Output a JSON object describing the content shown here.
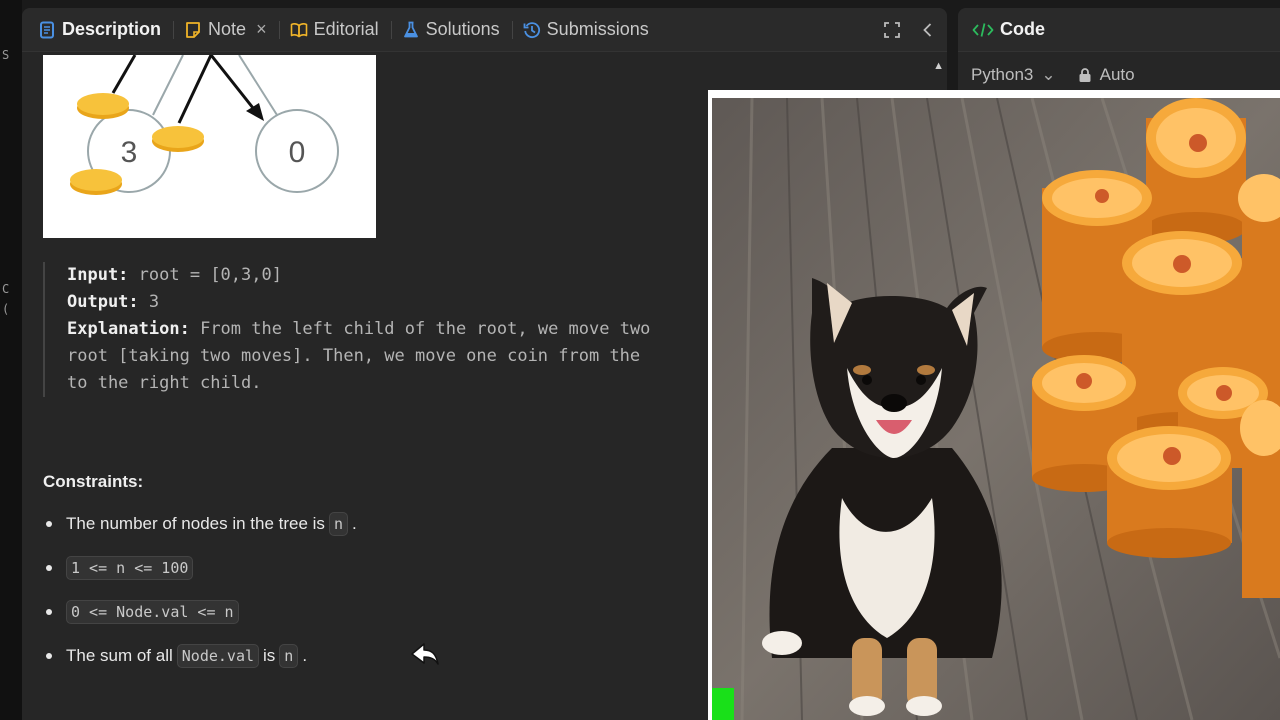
{
  "edge_chars": [
    "S",
    "C",
    "("
  ],
  "tabs": [
    {
      "label": "Description",
      "icon": "document-icon",
      "active": true
    },
    {
      "label": "Note",
      "icon": "note-icon",
      "closable": true
    },
    {
      "label": "Editorial",
      "icon": "book-icon"
    },
    {
      "label": "Solutions",
      "icon": "flask-icon"
    },
    {
      "label": "Submissions",
      "icon": "history-icon"
    }
  ],
  "tab_close_glyph": "×",
  "tree_figure": {
    "left_node": "3",
    "right_node": "0"
  },
  "example": {
    "input_label": "Input:",
    "input_value": "root = [0,3,0]",
    "output_label": "Output:",
    "output_value": "3",
    "explanation_label": "Explanation:",
    "explanation_line1": "From the left child of the root, we move two",
    "explanation_line2": "root [taking two moves]. Then, we move one coin from the",
    "explanation_line3": "to the right child."
  },
  "constraints": {
    "title": "Constraints:",
    "items": [
      {
        "before": "The number of nodes in the tree is",
        "code": "n",
        "after": "."
      },
      {
        "before": "",
        "code": "1 <= n <= 100",
        "after": ""
      },
      {
        "before": "",
        "code": "0 <= Node.val <= n",
        "after": ""
      },
      {
        "before": "The sum of all",
        "code": "Node.val",
        "middle": "is",
        "code2": "n",
        "after": "."
      }
    ]
  },
  "code_panel": {
    "title": "Code",
    "language": "Python3",
    "mode": "Auto"
  },
  "colors": {
    "panel_bg": "#262626",
    "accent_green": "#2cbb5d",
    "icon_blue": "#4a90e2",
    "icon_gold": "#f0b429",
    "coin": "#f6a93b"
  }
}
